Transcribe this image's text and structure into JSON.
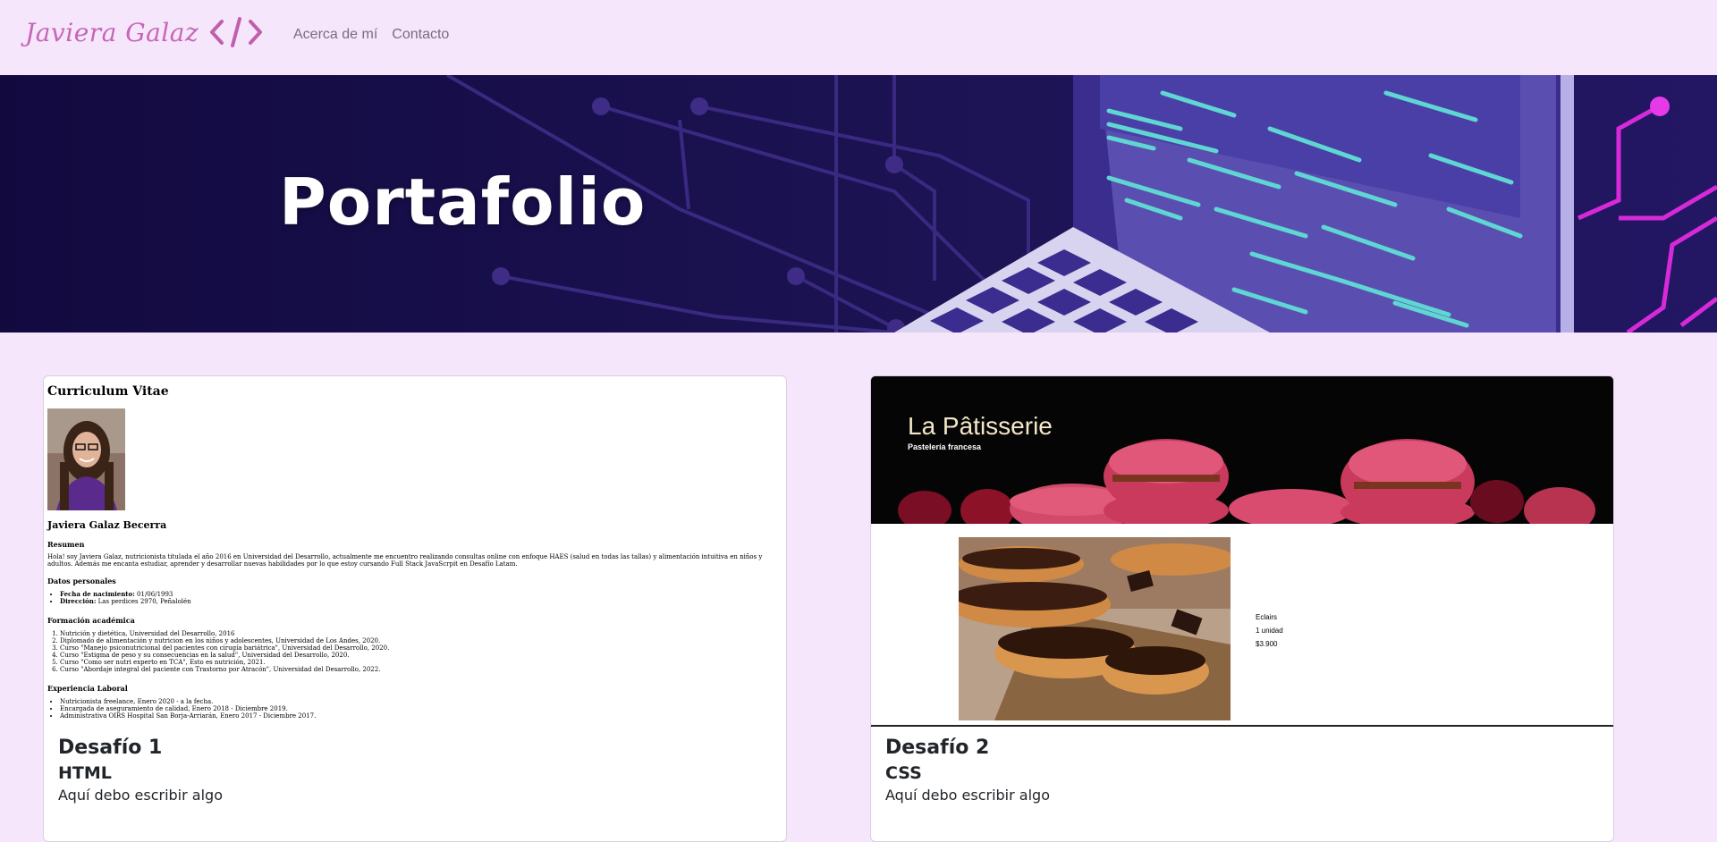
{
  "nav": {
    "brand": "Javiera Galaz",
    "links": [
      "Acerca de mí",
      "Contacto"
    ]
  },
  "hero": {
    "title": "Portafolio"
  },
  "colors": {
    "brand": "#c864b6",
    "hero_bg": "#150d45",
    "page_bg": "#f5e6fb"
  },
  "cards": [
    {
      "title": "Desafío 1",
      "subtitle": "HTML",
      "text": "Aquí debo escribir algo",
      "preview": {
        "heading": "Curriculum Vitae",
        "name": "Javiera Galaz Becerra",
        "resumen_h": "Resumen",
        "resumen": "Hola! soy Javiera Galaz, nutricionista titulada el año 2016 en Universidad del Desarrollo, actualmente me encuentro realizando consultas online con enfoque HAES (salud en todas las tallas) y alimentación intuitiva en niños y adultos. Además me encanta estudiar, aprender y desarrollar nuevas habilidades por lo que estoy cursando Full Stack JavaScrpit en Desafío Latam.",
        "datos_h": "Datos personales",
        "datos": [
          {
            "label": "Fecha de nacimiento:",
            "value": "01/06/1993"
          },
          {
            "label": "Dirección:",
            "value": "Las perdices 2970, Peñalolén"
          }
        ],
        "formacion_h": "Formación académica",
        "formacion": [
          "Nutrición y dietética, Universidad del Desarrollo, 2016",
          "Diplomado de alimentación y nutricion en los niños y adolescentes, Universidad de Los Andes, 2020.",
          "Curso \"Manejo psiconutricional del pacientes con cirugía bariátrica\", Universidad del Desarrollo, 2020.",
          "Curso \"Estigma de peso y su consecuencias en la salud\", Universidad del Desarrollo, 2020.",
          "Curso \"Como ser nutri experto en TCA\", Esto es nutrición, 2021.",
          "Curso \"Abordaje integral del paciente con Trastorno por Atracón\", Universidad del Desarrollo, 2022."
        ],
        "experiencia_h": "Experiencia Laboral",
        "experiencia": [
          "Nutricionista freelance, Enero 2020 - a la fecha.",
          "Encargada de aseguramiento de calidad, Enero 2018 - Diciembre 2019.",
          "Administrativa OIRS Hospital San Borja-Arriarán, Enero 2017 - Diciembre 2017."
        ]
      }
    },
    {
      "title": "Desafío 2",
      "subtitle": "CSS",
      "text": "Aquí debo escribir algo",
      "preview": {
        "heading": "La Pâtisserie",
        "tagline": "Pastelería francesa",
        "product": "Eclairs",
        "qty": "1 unidad",
        "price": "$3.900"
      }
    }
  ]
}
